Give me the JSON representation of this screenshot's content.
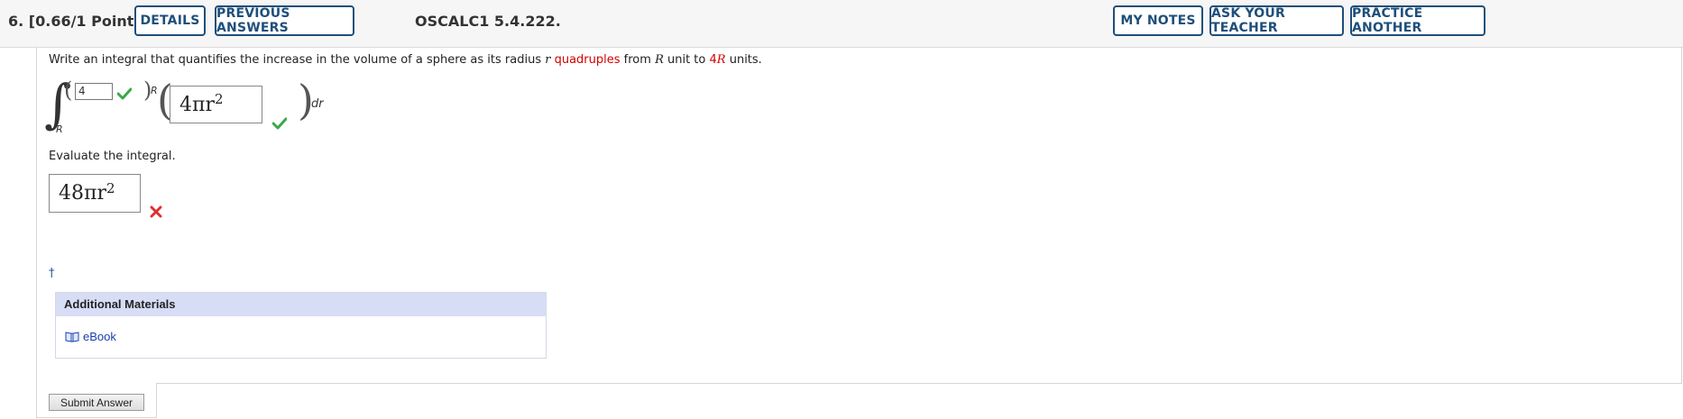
{
  "header": {
    "question_number": "6.",
    "points": "[0.66/1 Points]",
    "buttons": {
      "details": "DETAILS",
      "previous_answers": "PREVIOUS ANSWERS",
      "my_notes": "MY NOTES",
      "ask_teacher": "ASK YOUR TEACHER",
      "practice_another": "PRACTICE ANOTHER"
    },
    "question_code": "OSCALC1 5.4.222."
  },
  "prompt": {
    "part1": "Write an integral that quantifies the increase in the volume of a sphere as its radius ",
    "var_r": "r",
    "space1": " ",
    "highlight": "quadruples",
    "part2": " from ",
    "var_R1": "R",
    "part3": " unit to ",
    "highlight_4": "4",
    "var_R2": "R",
    "part4": " units."
  },
  "integral": {
    "lower_limit": "R",
    "upper_input_value": "4",
    "upper_suffix": "R",
    "integrand_value": "4πr",
    "integrand_exp": "2",
    "differential": "dr"
  },
  "evaluate": {
    "label": "Evaluate the integral.",
    "answer_value": "48πr",
    "answer_exp": "2"
  },
  "additional_materials": {
    "title": "Additional Materials",
    "ebook_label": "eBook"
  },
  "submit_label": "Submit Answer",
  "colors": {
    "accent": "#1e4f7a",
    "correct": "#3aa84a",
    "incorrect": "#e03030",
    "highlight": "#d40000"
  }
}
